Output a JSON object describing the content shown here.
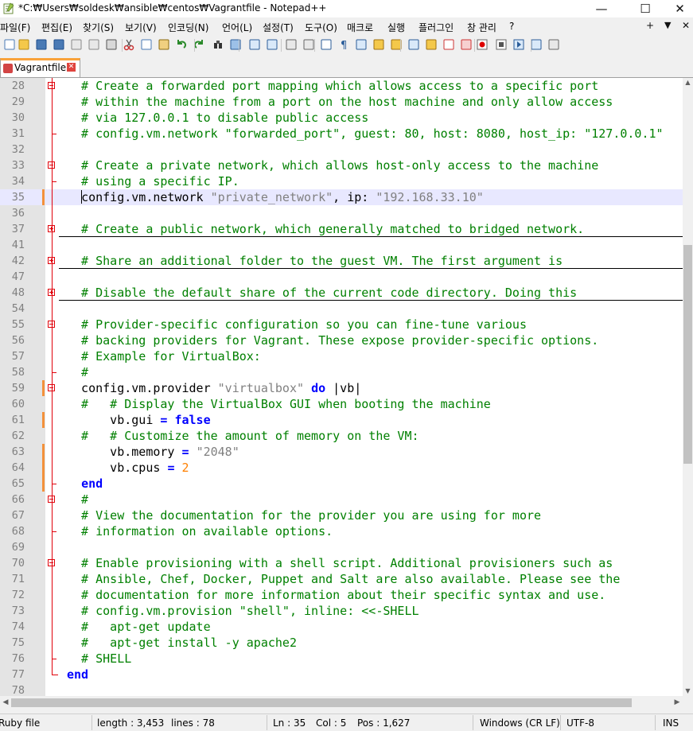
{
  "window": {
    "title": "*C:₩Users₩soldesk₩ansible₩centos₩Vagrantfile - Notepad++",
    "minimize_glyph": "—",
    "maximize_glyph": "☐",
    "close_glyph": "✕"
  },
  "menu": {
    "items": [
      "파일(F)",
      "편집(E)",
      "찾기(S)",
      "보기(V)",
      "인코딩(N)",
      "언어(L)",
      "설정(T)",
      "도구(O)",
      "매크로",
      "실행",
      "플러그인",
      "창 관리",
      "?"
    ],
    "right": [
      "+",
      "▼",
      "✕"
    ]
  },
  "toolbar": {
    "icons": [
      "new-file-icon",
      "open-file-icon",
      "save-icon",
      "save-all-icon",
      "close-icon",
      "close-all-icon",
      "print-icon",
      "cut-icon",
      "copy-icon",
      "paste-icon",
      "undo-icon",
      "redo-icon",
      "find-icon",
      "replace-icon",
      "zoom-in-icon",
      "zoom-out-icon",
      "sync-vertical-icon",
      "sync-horizontal-icon",
      "word-wrap-icon",
      "show-all-chars-icon",
      "indent-guide-icon",
      "user-lang-icon",
      "doc-map-icon",
      "function-list-icon",
      "folder-workspace-icon",
      "doc-list-icon",
      "monitoring-icon",
      "record-macro-icon",
      "stop-macro-icon",
      "play-macro-icon",
      "run-macro-multiple-icon",
      "save-macro-icon"
    ]
  },
  "tab": {
    "label": "Vagrantfile",
    "close_glyph": "✕"
  },
  "editor": {
    "lines": [
      {
        "n": "28",
        "fold": "open",
        "chg": false,
        "cur": false,
        "collapsed": false,
        "tokens": [
          [
            "c",
            "  # Create a forwarded port mapping which allows access to a specific port"
          ]
        ]
      },
      {
        "n": "29",
        "fold": "",
        "chg": false,
        "cur": false,
        "collapsed": false,
        "tokens": [
          [
            "c",
            "  # within the machine from a port on the host machine and only allow access"
          ]
        ]
      },
      {
        "n": "30",
        "fold": "",
        "chg": false,
        "cur": false,
        "collapsed": false,
        "tokens": [
          [
            "c",
            "  # via 127.0.0.1 to disable public access"
          ]
        ]
      },
      {
        "n": "31",
        "fold": "end",
        "chg": false,
        "cur": false,
        "collapsed": false,
        "tokens": [
          [
            "c",
            "  # config.vm.network \"forwarded_port\", guest: 80, host: 8080, host_ip: \"127.0.0.1\""
          ]
        ]
      },
      {
        "n": "32",
        "fold": "",
        "chg": false,
        "cur": false,
        "collapsed": false,
        "tokens": []
      },
      {
        "n": "33",
        "fold": "open",
        "chg": false,
        "cur": false,
        "collapsed": false,
        "tokens": [
          [
            "c",
            "  # Create a private network, which allows host-only access to the machine"
          ]
        ]
      },
      {
        "n": "34",
        "fold": "end",
        "chg": false,
        "cur": false,
        "collapsed": false,
        "tokens": [
          [
            "c",
            "  # using a specific IP."
          ]
        ]
      },
      {
        "n": "35",
        "fold": "",
        "chg": true,
        "cur": true,
        "collapsed": false,
        "tokens": [
          [
            "p",
            "  "
          ],
          [
            "caret",
            ""
          ],
          [
            "p",
            "config.vm.network "
          ],
          [
            "s",
            "\"private_network\""
          ],
          [
            "p",
            ", ip: "
          ],
          [
            "s",
            "\"192.168.33.10\""
          ]
        ]
      },
      {
        "n": "36",
        "fold": "",
        "chg": false,
        "cur": false,
        "collapsed": false,
        "tokens": []
      },
      {
        "n": "37",
        "fold": "closed",
        "chg": false,
        "cur": false,
        "collapsed": true,
        "tokens": [
          [
            "c",
            "  # Create a public network, which generally matched to bridged network."
          ]
        ]
      },
      {
        "n": "41",
        "fold": "",
        "chg": false,
        "cur": false,
        "collapsed": false,
        "tokens": []
      },
      {
        "n": "42",
        "fold": "closed",
        "chg": false,
        "cur": false,
        "collapsed": true,
        "tokens": [
          [
            "c",
            "  # Share an additional folder to the guest VM. The first argument is"
          ]
        ]
      },
      {
        "n": "47",
        "fold": "",
        "chg": false,
        "cur": false,
        "collapsed": false,
        "tokens": []
      },
      {
        "n": "48",
        "fold": "closed",
        "chg": false,
        "cur": false,
        "collapsed": true,
        "tokens": [
          [
            "c",
            "  # Disable the default share of the current code directory. Doing this"
          ]
        ]
      },
      {
        "n": "54",
        "fold": "",
        "chg": false,
        "cur": false,
        "collapsed": false,
        "tokens": []
      },
      {
        "n": "55",
        "fold": "open",
        "chg": false,
        "cur": false,
        "collapsed": false,
        "tokens": [
          [
            "c",
            "  # Provider-specific configuration so you can fine-tune various"
          ]
        ]
      },
      {
        "n": "56",
        "fold": "",
        "chg": false,
        "cur": false,
        "collapsed": false,
        "tokens": [
          [
            "c",
            "  # backing providers for Vagrant. These expose provider-specific options."
          ]
        ]
      },
      {
        "n": "57",
        "fold": "",
        "chg": false,
        "cur": false,
        "collapsed": false,
        "tokens": [
          [
            "c",
            "  # Example for VirtualBox:"
          ]
        ]
      },
      {
        "n": "58",
        "fold": "end",
        "chg": false,
        "cur": false,
        "collapsed": false,
        "tokens": [
          [
            "c",
            "  #"
          ]
        ]
      },
      {
        "n": "59",
        "fold": "open",
        "chg": true,
        "cur": false,
        "collapsed": false,
        "tokens": [
          [
            "p",
            "  config.vm.provider "
          ],
          [
            "s",
            "\"virtualbox\""
          ],
          [
            "p",
            " "
          ],
          [
            "k",
            "do"
          ],
          [
            "p",
            " |vb|"
          ]
        ]
      },
      {
        "n": "60",
        "fold": "",
        "chg": false,
        "cur": false,
        "collapsed": false,
        "tokens": [
          [
            "c",
            "  #   # Display the VirtualBox GUI when booting the machine"
          ]
        ]
      },
      {
        "n": "61",
        "fold": "",
        "chg": true,
        "cur": false,
        "collapsed": false,
        "tokens": [
          [
            "p",
            "      vb.gui "
          ],
          [
            "k",
            "="
          ],
          [
            "p",
            " "
          ],
          [
            "k",
            "false"
          ]
        ]
      },
      {
        "n": "62",
        "fold": "",
        "chg": false,
        "cur": false,
        "collapsed": false,
        "tokens": [
          [
            "c",
            "  #   # Customize the amount of memory on the VM:"
          ]
        ]
      },
      {
        "n": "63",
        "fold": "",
        "chg": true,
        "cur": false,
        "collapsed": false,
        "tokens": [
          [
            "p",
            "      vb.memory "
          ],
          [
            "k",
            "="
          ],
          [
            "p",
            " "
          ],
          [
            "s",
            "\"2048\""
          ]
        ]
      },
      {
        "n": "64",
        "fold": "",
        "chg": true,
        "cur": false,
        "collapsed": false,
        "tokens": [
          [
            "p",
            "      vb.cpus "
          ],
          [
            "k",
            "="
          ],
          [
            "p",
            " "
          ],
          [
            "n",
            "2"
          ]
        ]
      },
      {
        "n": "65",
        "fold": "end",
        "chg": true,
        "cur": false,
        "collapsed": false,
        "tokens": [
          [
            "p",
            "  "
          ],
          [
            "k",
            "end"
          ]
        ]
      },
      {
        "n": "66",
        "fold": "open",
        "chg": false,
        "cur": false,
        "collapsed": false,
        "tokens": [
          [
            "c",
            "  #"
          ]
        ]
      },
      {
        "n": "67",
        "fold": "",
        "chg": false,
        "cur": false,
        "collapsed": false,
        "tokens": [
          [
            "c",
            "  # View the documentation for the provider you are using for more"
          ]
        ]
      },
      {
        "n": "68",
        "fold": "end",
        "chg": false,
        "cur": false,
        "collapsed": false,
        "tokens": [
          [
            "c",
            "  # information on available options."
          ]
        ]
      },
      {
        "n": "69",
        "fold": "",
        "chg": false,
        "cur": false,
        "collapsed": false,
        "tokens": []
      },
      {
        "n": "70",
        "fold": "open",
        "chg": false,
        "cur": false,
        "collapsed": false,
        "tokens": [
          [
            "c",
            "  # Enable provisioning with a shell script. Additional provisioners such as"
          ]
        ]
      },
      {
        "n": "71",
        "fold": "",
        "chg": false,
        "cur": false,
        "collapsed": false,
        "tokens": [
          [
            "c",
            "  # Ansible, Chef, Docker, Puppet and Salt are also available. Please see the"
          ]
        ]
      },
      {
        "n": "72",
        "fold": "",
        "chg": false,
        "cur": false,
        "collapsed": false,
        "tokens": [
          [
            "c",
            "  # documentation for more information about their specific syntax and use."
          ]
        ]
      },
      {
        "n": "73",
        "fold": "",
        "chg": false,
        "cur": false,
        "collapsed": false,
        "tokens": [
          [
            "c",
            "  # config.vm.provision \"shell\", inline: <<-SHELL"
          ]
        ]
      },
      {
        "n": "74",
        "fold": "",
        "chg": false,
        "cur": false,
        "collapsed": false,
        "tokens": [
          [
            "c",
            "  #   apt-get update"
          ]
        ]
      },
      {
        "n": "75",
        "fold": "",
        "chg": false,
        "cur": false,
        "collapsed": false,
        "tokens": [
          [
            "c",
            "  #   apt-get install -y apache2"
          ]
        ]
      },
      {
        "n": "76",
        "fold": "end",
        "chg": false,
        "cur": false,
        "collapsed": false,
        "tokens": [
          [
            "c",
            "  # SHELL"
          ]
        ]
      },
      {
        "n": "77",
        "fold": "docend",
        "chg": false,
        "cur": false,
        "collapsed": false,
        "tokens": [
          [
            "k",
            "end"
          ]
        ]
      },
      {
        "n": "78",
        "fold": "",
        "chg": false,
        "cur": false,
        "collapsed": false,
        "tokens": []
      }
    ]
  },
  "statusbar": {
    "language": "Ruby file",
    "length": "length : 3,453",
    "lines": "lines : 78",
    "ln": "Ln : 35",
    "col": "Col : 5",
    "pos": "Pos : 1,627",
    "eol": "Windows (CR LF)",
    "encoding": "UTF-8",
    "ins": "INS"
  },
  "colors": {
    "comment": "#008000",
    "keyword": "#0000ff",
    "string": "#808080",
    "number": "#ff8000",
    "change_marker": "#f3913b",
    "fold": "#e0000a",
    "current_line": "#e8e8ff"
  }
}
